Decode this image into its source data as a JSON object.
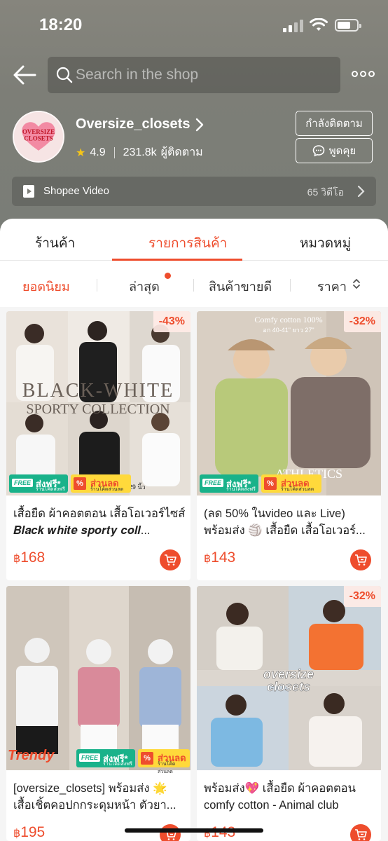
{
  "status_bar": {
    "time": "18:20"
  },
  "search": {
    "placeholder": "Search in the shop"
  },
  "shop": {
    "name": "Oversize_closets",
    "logo_text_top": "OVERSIZE",
    "logo_text_bottom": "CLOSETS",
    "rating": "4.9",
    "followers": "231.8k",
    "followers_label": "ผู้ติดตาม",
    "follow_button": "กำลังติดตาม",
    "chat_button": "พูดคุย"
  },
  "video_bar": {
    "label": "Shopee Video",
    "count": "65 วิดีโอ"
  },
  "tabs": [
    {
      "label": "ร้านค้า",
      "active": false
    },
    {
      "label": "รายการสินค้า",
      "active": true
    },
    {
      "label": "หมวดหมู่",
      "active": false
    }
  ],
  "sorts": [
    {
      "label": "ยอดนิยม",
      "active": true
    },
    {
      "label": "ล่าสุด",
      "active": false,
      "dot": true
    },
    {
      "label": "สินค้าขายดี",
      "active": false
    },
    {
      "label": "ราคา",
      "active": false
    }
  ],
  "badges": {
    "free_tag": "FREE",
    "free_text": "ส่งฟรี*",
    "free_sub": "ร้านโค้ดส่งฟรี",
    "sale_pct": "%",
    "sale_text": "ส่วนลด",
    "sale_sub": "ร้านโค้ดส่วนลด",
    "trendy": "Trendy"
  },
  "products": [
    {
      "title": "เสื้อยืด ผ้าคอตตอน เสื้อโอเวอร์ไซส์ 𝑩𝒍𝒂𝒄𝒌 𝒘𝒉𝒊𝒕𝒆 𝒔𝒑𝒐𝒓𝒕𝒚 𝒄𝒐𝒍𝒍...",
      "price": "168",
      "currency": "฿",
      "discount": "-43%",
      "image_text_1": "BLACK-WHITE",
      "image_text_2": "SPORTY COLLECTION",
      "image_text_3": "อก 29 นิ้ว"
    },
    {
      "title": "(ลด 50% ในvideo และ Live) พร้อมส่ง 🏐 เสื้อยืด เสื้อโอเวอร์...",
      "price": "143",
      "currency": "฿",
      "discount": "-32%",
      "image_text_1": "Comfy cotton 100%",
      "image_text_2": "อก 40-41\" ยาว 27\"",
      "image_text_3": "ATHLETICS"
    },
    {
      "title": "[oversize_closets] พร้อมส่ง 🌟 เสื้อเชิ้ตคอปกกระดุมหน้า ตัวยา...",
      "price": "195",
      "currency": "฿",
      "discount": ""
    },
    {
      "title": "พร้อมส่ง💖 เสื้อยืด ผ้าคอตตอน comfy cotton - Animal club",
      "price": "143",
      "currency": "฿",
      "discount": "-32%",
      "image_text_1": "oversize",
      "image_text_2": "closets"
    }
  ],
  "colors": {
    "accent": "#ee4d2d",
    "free_badge": "#19b28a",
    "sale_badge": "#ffd93b"
  }
}
